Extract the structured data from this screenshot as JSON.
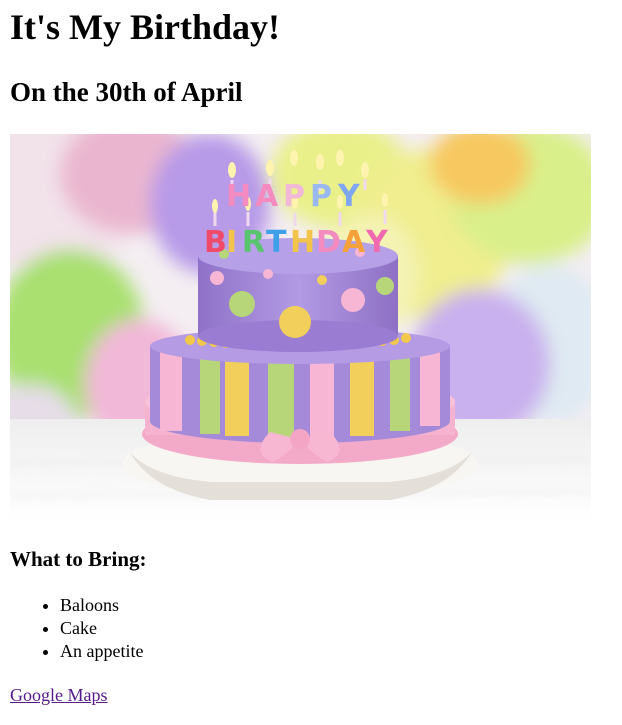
{
  "page": {
    "title": "It's My Birthday!",
    "subtitle": "On the 30th of April",
    "bring_heading": "What to Bring:",
    "bring_items": [
      "Baloons",
      "Cake",
      "An appetite"
    ],
    "link_text": "Google Maps"
  },
  "image": {
    "cake_letters": [
      "H",
      "A",
      "P",
      "P",
      "Y",
      "B",
      "I",
      "R",
      "T",
      "H",
      "D",
      "A",
      "Y"
    ]
  },
  "colors": {
    "link": "#551a8b",
    "cake_purple": "#a48ad8",
    "cake_pink": "#f6b6d4",
    "cake_yellow": "#f2cf5a",
    "cake_green": "#b7d67a"
  }
}
